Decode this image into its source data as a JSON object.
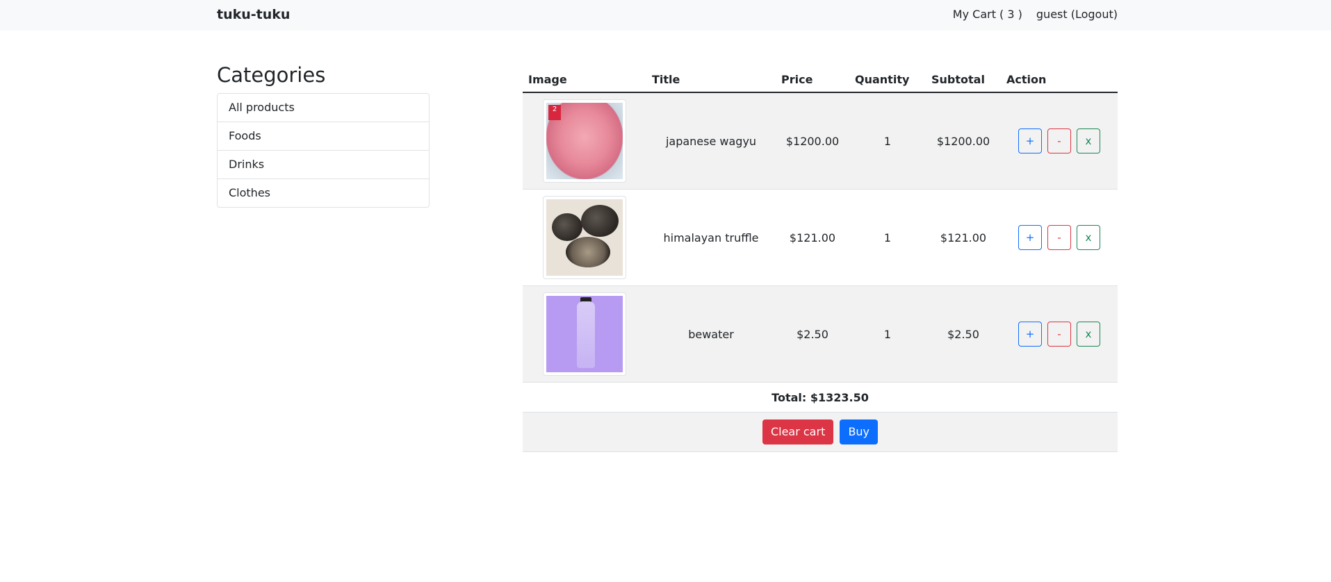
{
  "nav": {
    "brand": "tuku-tuku",
    "cart_label": "My Cart ( 3 )",
    "user_label": "guest (Logout)"
  },
  "sidebar": {
    "heading": "Categories",
    "items": [
      "All products",
      "Foods",
      "Drinks",
      "Clothes"
    ]
  },
  "cart": {
    "headers": {
      "image": "Image",
      "title": "Title",
      "price": "Price",
      "quantity": "Quantity",
      "subtotal": "Subtotal",
      "action": "Action"
    },
    "items": [
      {
        "title": "japanese wagyu",
        "price": "$1200.00",
        "quantity": "1",
        "subtotal": "$1200.00",
        "image_icon": "wagyu-image",
        "badge": "2"
      },
      {
        "title": "himalayan truffle",
        "price": "$121.00",
        "quantity": "1",
        "subtotal": "$121.00",
        "image_icon": "truffle-image"
      },
      {
        "title": "bewater",
        "price": "$2.50",
        "quantity": "1",
        "subtotal": "$2.50",
        "image_icon": "water-bottle-image"
      }
    ],
    "action_labels": {
      "plus": "+",
      "minus": "-",
      "remove": "x"
    },
    "total": "Total: $1323.50",
    "clear_label": "Clear cart",
    "buy_label": "Buy"
  },
  "colors": {
    "primary": "#0d6efd",
    "danger": "#dc3545",
    "success": "#198754",
    "navbar_bg": "#f8f9fa",
    "stripe": "#f2f2f2"
  }
}
